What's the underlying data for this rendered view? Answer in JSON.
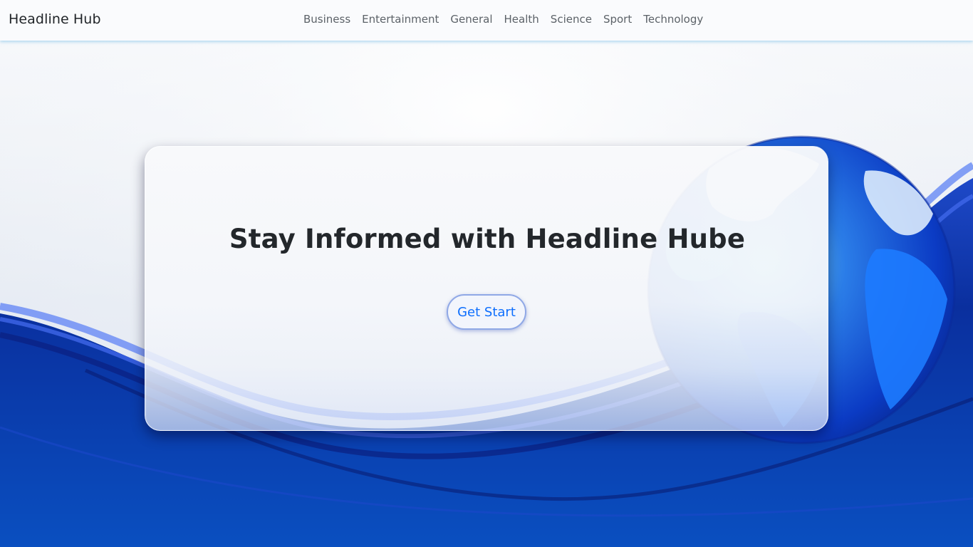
{
  "navbar": {
    "brand": "Headline Hub",
    "links": [
      {
        "label": "Business"
      },
      {
        "label": "Entertainment"
      },
      {
        "label": "General"
      },
      {
        "label": "Health"
      },
      {
        "label": "Science"
      },
      {
        "label": "Sport"
      },
      {
        "label": "Technology"
      }
    ]
  },
  "hero": {
    "title": "Stay Informed with Headline Hube",
    "cta_label": "Get Start"
  },
  "background": {
    "image": "blue-wave-globe",
    "icon": "globe-icon"
  },
  "colors": {
    "accent": "#0d6efd",
    "wave_dark": "#0a2a9a",
    "wave_mid": "#1a4fd8",
    "globe_light": "#5fd6ff",
    "text": "#212529"
  }
}
